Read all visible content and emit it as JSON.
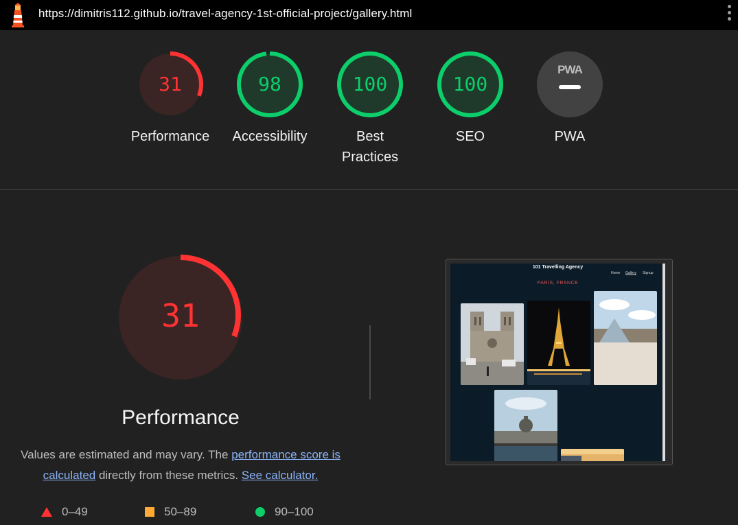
{
  "browser": {
    "url": "https://dimitris112.github.io/travel-agency-1st-official-project/gallery.html",
    "logo_icon": "lighthouse-icon",
    "menu_icon": "kebab-menu-icon"
  },
  "gauges": [
    {
      "label": "Performance",
      "score": "31",
      "score_value": 31,
      "status": "fail"
    },
    {
      "label": "Accessibility",
      "score": "98",
      "score_value": 98,
      "status": "pass"
    },
    {
      "label": "Best Practices",
      "score": "100",
      "score_value": 100,
      "status": "pass"
    },
    {
      "label": "SEO",
      "score": "100",
      "score_value": 100,
      "status": "pass"
    },
    {
      "label": "PWA",
      "score": "",
      "icon": "pwa-icon",
      "status": "na"
    }
  ],
  "performance": {
    "score": "31",
    "score_value": 31,
    "title": "Performance",
    "desc_before": "Values are estimated and may vary. The ",
    "desc_link1": "performance score is calculated",
    "desc_middle": " directly from these metrics. ",
    "desc_link2": "See calculator."
  },
  "legend": [
    {
      "range": "0–49",
      "shape": "triangle",
      "color": "#ff3333"
    },
    {
      "range": "50–89",
      "shape": "square",
      "color": "#ffaa33"
    },
    {
      "range": "90–100",
      "shape": "circle",
      "color": "#0cce6b"
    }
  ],
  "colors": {
    "fail": "#ff3333",
    "fail_bg": "#3a2424",
    "pass": "#0cce6b",
    "pass_bg": "#1f3a2a",
    "na_bg": "#424242"
  },
  "screenshot": {
    "brand": "101 Travelling Agency",
    "nav": [
      "Home",
      "Gallery",
      "Signup"
    ],
    "city": "PARIS, FRANCE",
    "photos": [
      "notre-dame-photo",
      "eiffel-tower-photo",
      "louvre-pyramid-photo",
      "institut-de-france-photo",
      "sunset-photo"
    ]
  }
}
